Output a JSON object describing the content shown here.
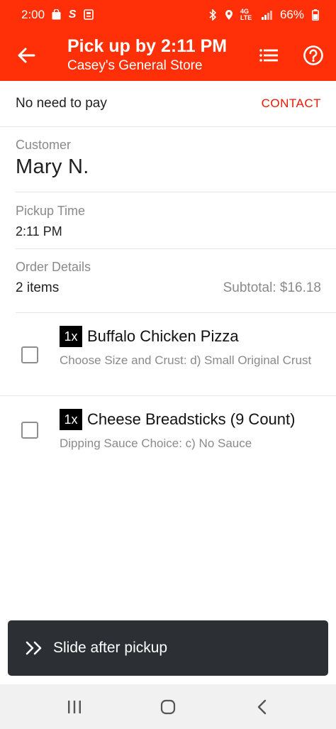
{
  "status_bar": {
    "time": "2:00",
    "network": "4G LTE",
    "battery": "66%"
  },
  "header": {
    "title": "Pick up by 2:11 PM",
    "subtitle": "Casey's General Store"
  },
  "payment": {
    "text": "No need to pay",
    "contact_label": "CONTACT"
  },
  "customer": {
    "label": "Customer",
    "name": "Mary N."
  },
  "pickup": {
    "label": "Pickup Time",
    "time": "2:11 PM"
  },
  "order": {
    "label": "Order Details",
    "item_count": "2 items",
    "subtotal": "Subtotal: $16.18"
  },
  "items": [
    {
      "qty": "1x",
      "name": "Buffalo Chicken Pizza",
      "details": "Choose Size and Crust: d) Small Original Crust",
      "checked": false
    },
    {
      "qty": "1x",
      "name": "Cheese Breadsticks (9 Count)",
      "details": "Dipping Sauce Choice: c) No Sauce",
      "checked": false
    }
  ],
  "slide_action": {
    "label": "Slide after pickup"
  },
  "colors": {
    "brand": "#ff3008",
    "accent_text": "#eb1700",
    "action_bar": "#2c3035"
  }
}
